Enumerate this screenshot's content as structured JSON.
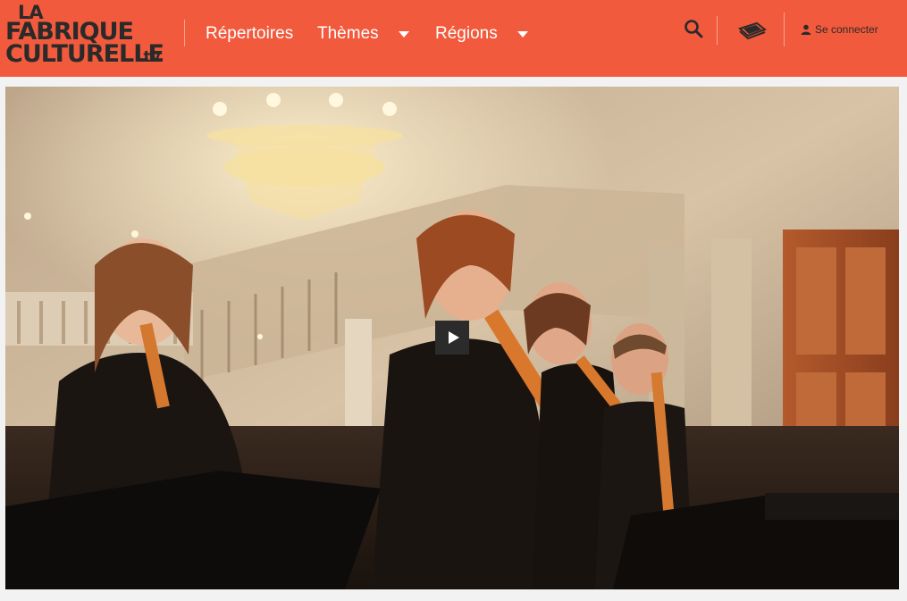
{
  "header": {
    "logo": {
      "line1": "LA",
      "line2": "FABRIQUE",
      "line3": "CULTURELLE",
      "suffix": ".tv"
    },
    "nav": [
      {
        "label": "Répertoires",
        "has_dropdown": false
      },
      {
        "label": "Thèmes",
        "has_dropdown": true
      },
      {
        "label": "Régions",
        "has_dropdown": true
      }
    ],
    "icons": {
      "search": "search-icon",
      "program": "ticket-icon",
      "user": "user-icon"
    },
    "login_label": "Se connecter",
    "colors": {
      "bar": "#f15a3c",
      "text_dark": "#2a2a2a",
      "nav_text": "#ffffff"
    }
  },
  "video": {
    "play_icon": "play-icon",
    "scene": "four recorder players in a concert hall with chandelier"
  }
}
